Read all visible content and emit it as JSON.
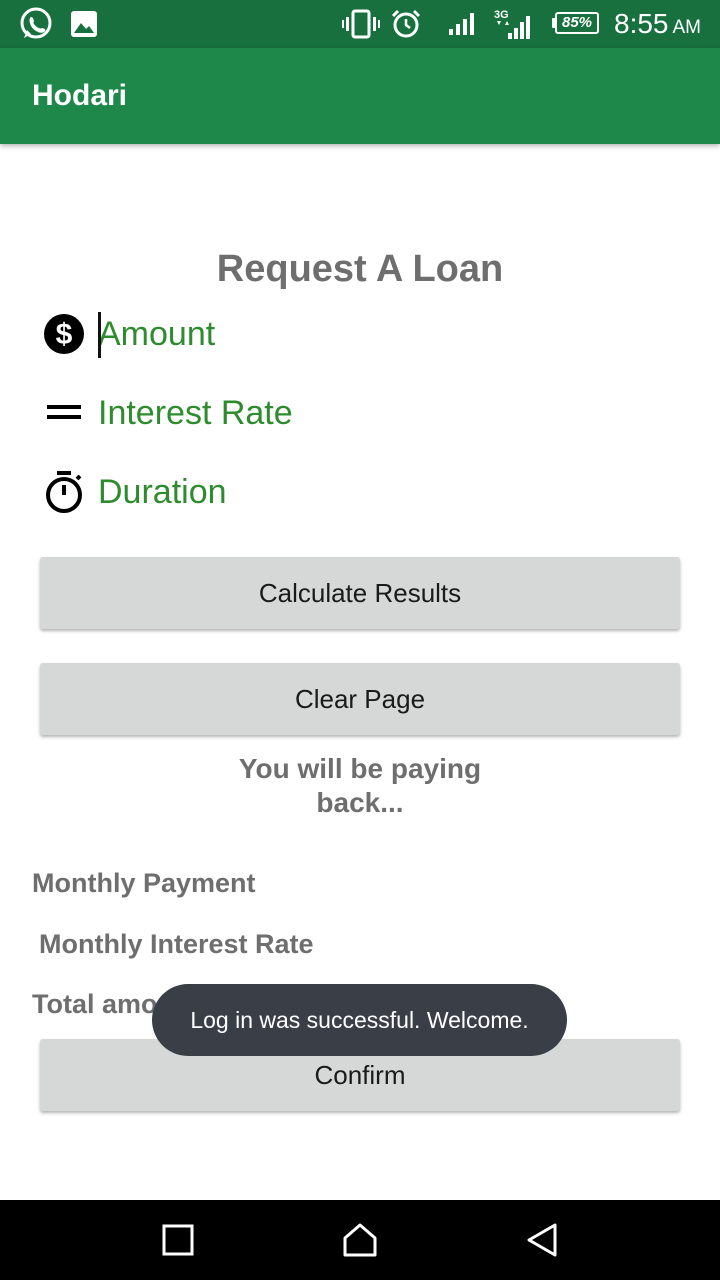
{
  "status_bar": {
    "icons": [
      "whatsapp-icon",
      "image-icon",
      "vibrate-icon",
      "alarm-icon",
      "signal-icon",
      "signal-3g-icon",
      "battery-icon"
    ],
    "battery": "85%",
    "time": "8:55",
    "ampm": "AM"
  },
  "app_bar": {
    "title": "Hodari"
  },
  "form": {
    "heading": "Request A Loan",
    "amount_placeholder": "Amount",
    "interest_placeholder": "Interest Rate",
    "duration_placeholder": "Duration",
    "calculate_label": "Calculate Results",
    "clear_label": "Clear Page"
  },
  "results": {
    "pay_back_line1": "You will be paying",
    "pay_back_line2": "back...",
    "monthly_payment": "Monthly Payment",
    "monthly_interest": "Monthly Interest Rate",
    "total_amount": "Total amount paid end of period",
    "confirm_label": "Confirm"
  },
  "toast": {
    "message": "Log in was successful. Welcome."
  },
  "nav_bar": {
    "buttons": [
      "recents-button",
      "home-button",
      "back-button"
    ]
  },
  "colors": {
    "status_bar": "#17703e",
    "app_bar": "#1e874a",
    "accent_green": "#2e8b2e",
    "button_bg": "#d6d7d7",
    "toast_bg": "#3a3e47"
  }
}
